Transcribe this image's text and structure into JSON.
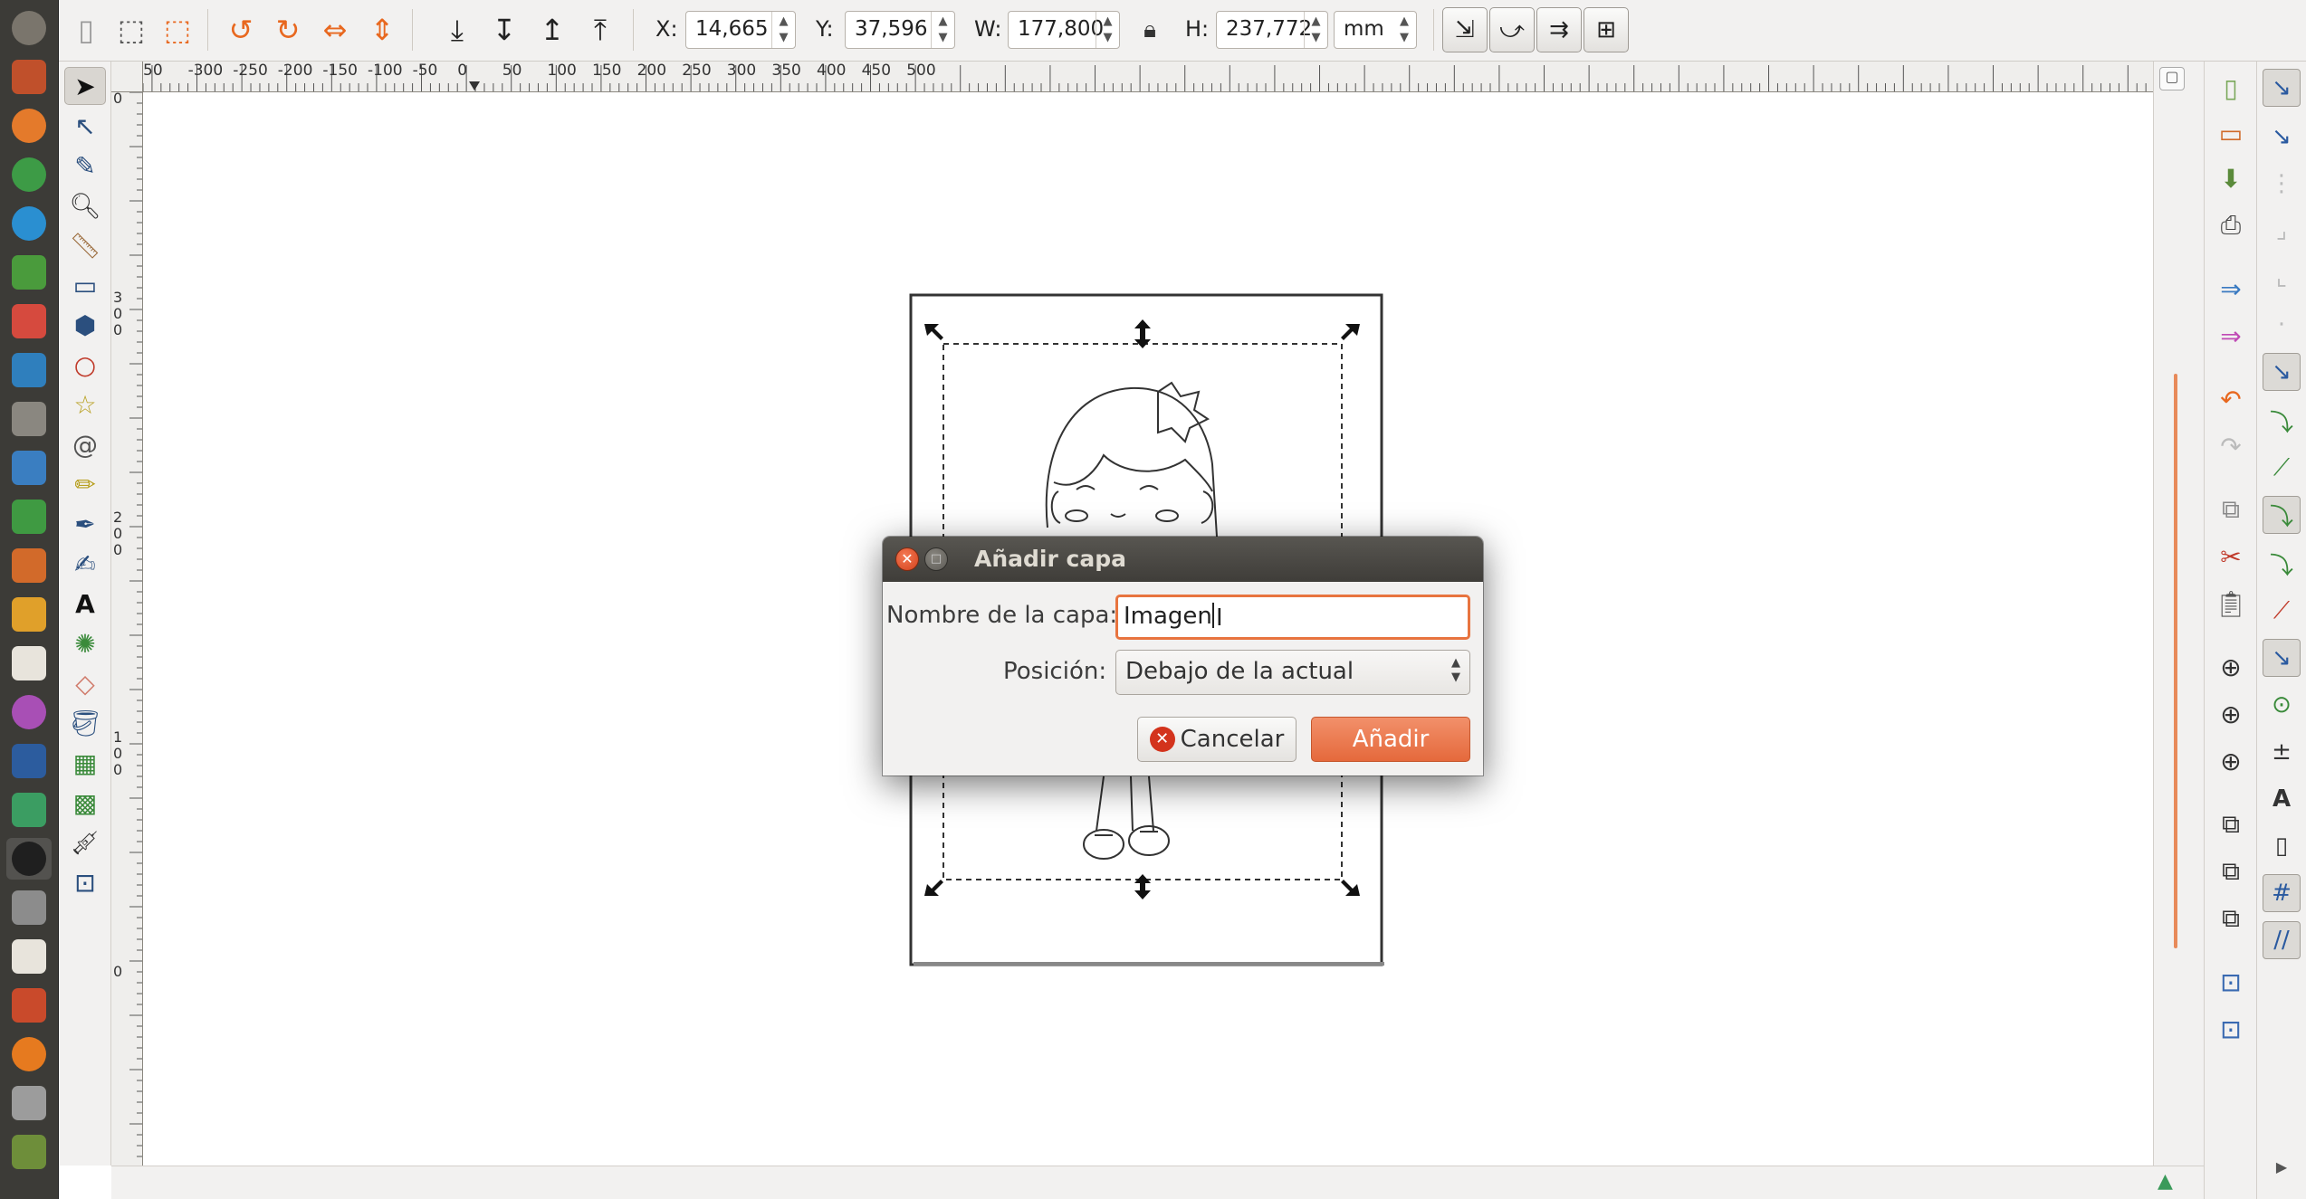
{
  "toolbar": {
    "x_label": "X:",
    "x_value": "14,665",
    "y_label": "Y:",
    "y_value": "37,596",
    "w_label": "W:",
    "w_value": "177,800",
    "h_label": "H:",
    "h_value": "237,772",
    "unit": "mm"
  },
  "rulers": {
    "h_ticks": [
      "50",
      "-300",
      "-250",
      "-200",
      "-150",
      "-100",
      "-50",
      "0",
      "50",
      "100",
      "150",
      "200",
      "250",
      "300",
      "350",
      "400",
      "450",
      "500"
    ],
    "v_ticks": [
      "0",
      "3 0 0",
      "2 0 0",
      "1 0 0",
      "0"
    ]
  },
  "dialog": {
    "title": "Añadir capa",
    "name_label": "Nombre de la capa:",
    "name_value": "Imagen",
    "position_label": "Posición:",
    "position_value": "Debajo de la actual",
    "cancel_label": "Cancelar",
    "add_label": "Añadir"
  },
  "colors": {
    "accent": "#e8681f",
    "dialog_title_bg": "#4a4844",
    "launcher_bg": "#3c3b37",
    "close_button": "#e2552c"
  }
}
